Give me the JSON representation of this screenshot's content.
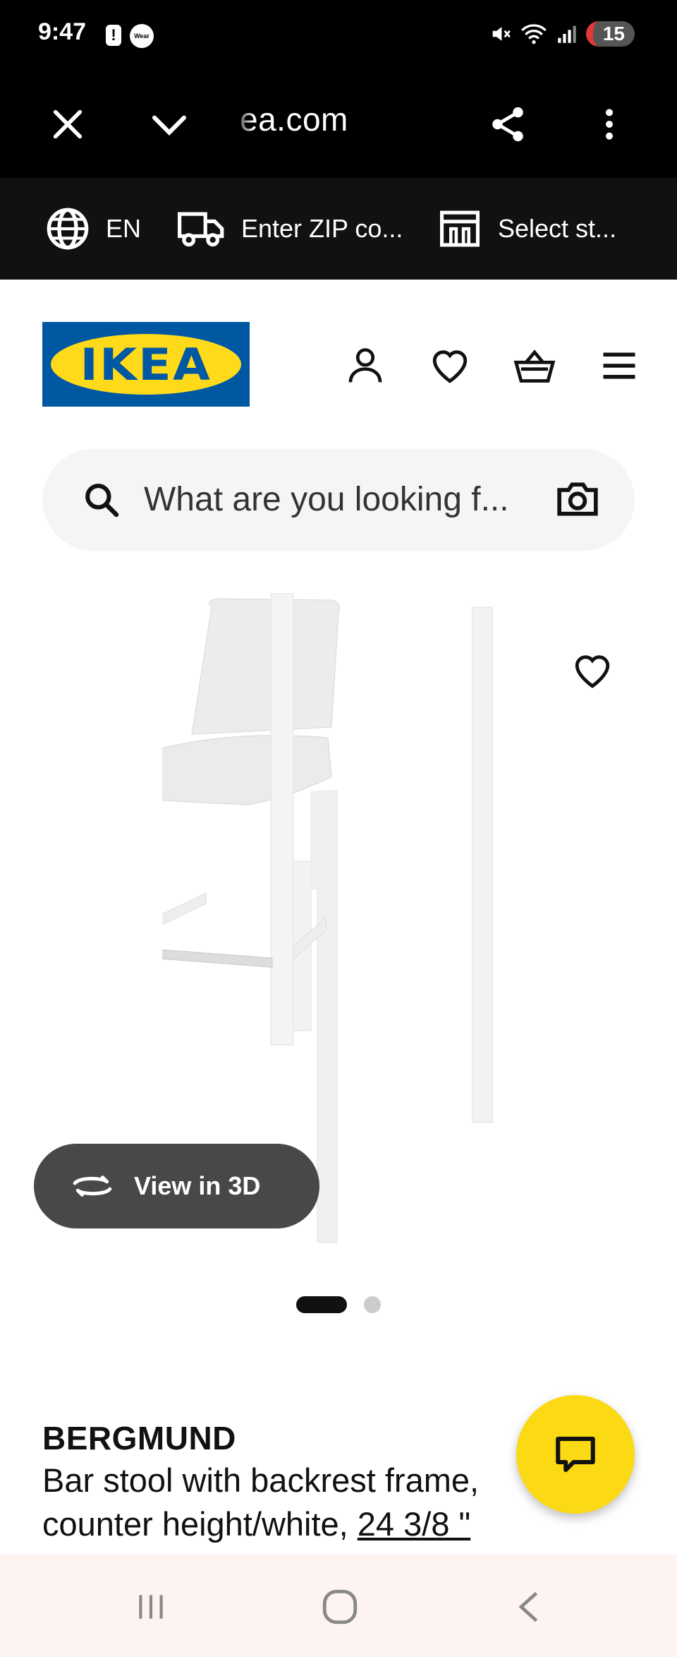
{
  "status_bar": {
    "time": "9:47",
    "alert_glyph": "!",
    "wear_label": "Wear",
    "battery": "15"
  },
  "browser": {
    "url": "ea.com",
    "icons": [
      "close-icon",
      "chevron-down-icon",
      "share-icon",
      "more-vert-icon"
    ]
  },
  "store_strip": {
    "language": "EN",
    "zip": "Enter ZIP co...",
    "store": "Select st..."
  },
  "header": {
    "logo_text": "IKEA",
    "icons": [
      "account-icon",
      "heart-icon",
      "basket-icon",
      "menu-icon"
    ]
  },
  "search": {
    "placeholder": "What are you looking f..."
  },
  "product": {
    "view3d_label": "View in 3D",
    "image_count": 2,
    "active_image": 1,
    "name": "BERGMUND",
    "desc_line1": "Bar stool with backrest frame,",
    "desc_line2_prefix": "counter height/white,",
    "measure": "24 3/8 \""
  },
  "colors": {
    "ikea_blue": "#0058a3",
    "ikea_yellow": "#ffda1a",
    "chat_yellow": "#fbd914",
    "view3d_bg": "#484848"
  }
}
